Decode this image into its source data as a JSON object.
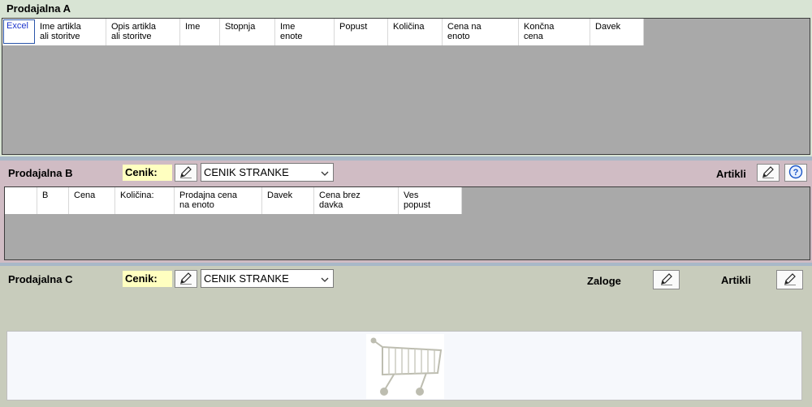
{
  "sectionA": {
    "title": "Prodajalna A",
    "columns": [
      "Excel",
      "Ime artikla\nali storitve",
      "Opis artikla\nali storitve",
      "Ime",
      "Stopnja",
      "Ime\nenote",
      "Popust",
      "Količina",
      "Cena na\nenoto",
      "Končna\ncena",
      "Davek"
    ]
  },
  "sectionB": {
    "title": "Prodajalna B",
    "cenik_label": "Cenik:",
    "cenik_value": "CENIK STRANKE",
    "artikli_label": "Artikli",
    "columns": [
      "",
      "B",
      "Cena",
      "Količina:",
      "Prodajna cena\nna enoto",
      "Davek",
      "Cena brez\ndavka",
      "Ves\npopust"
    ]
  },
  "sectionC": {
    "title": "Prodajalna C",
    "cenik_label": "Cenik:",
    "cenik_value": "CENIK STRANKE",
    "zaloge_label": "Zaloge",
    "artikli_label": "Artikli"
  },
  "colors": {
    "sectionA_bg": "#d8e4d4",
    "sectionB_bg": "#d0bcc4",
    "sectionC_bg": "#c8ccbc",
    "grid_bg": "#a9a9a9",
    "cenik_highlight": "#ffffc0"
  },
  "icons": {
    "edit": "pencil-icon",
    "help": "question-icon",
    "dropdown": "chevron-down-icon",
    "cart": "shopping-cart-icon"
  }
}
